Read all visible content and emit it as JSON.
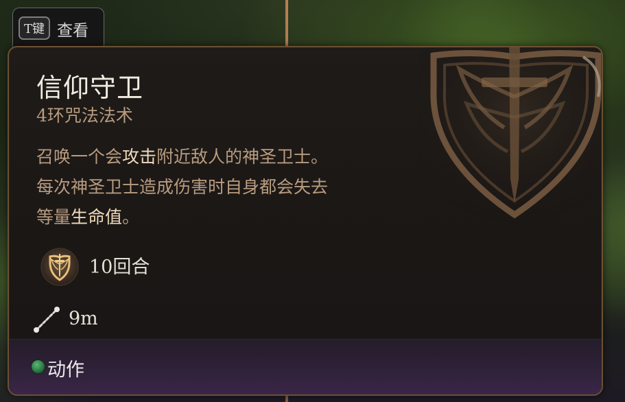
{
  "view_tab": {
    "key": "T键",
    "label": "查看"
  },
  "spell": {
    "name": "信仰守卫",
    "level_school": "4环咒法法术",
    "description": {
      "seg1": "召唤一个会",
      "kw1": "攻击",
      "seg2": "附近敌人的神圣卫士。",
      "line2": "每次神圣卫士造成伤害时自身都会失去",
      "seg3": "等量",
      "kw2": "生命值",
      "seg4": "。"
    },
    "duration": "10回合",
    "range": "9m",
    "cost": "动作"
  },
  "icons": {
    "emblem": "guardian-of-faith-shield-icon",
    "duration": "guardian-of-faith-small-icon",
    "range": "ruler-range-icon",
    "action": "action-resource-dot-icon"
  },
  "colors": {
    "accent_frame": "#6b5032",
    "keyword": "#f0dcbc",
    "body_text": "#b89c80",
    "action_dot": "#3a8f55"
  }
}
